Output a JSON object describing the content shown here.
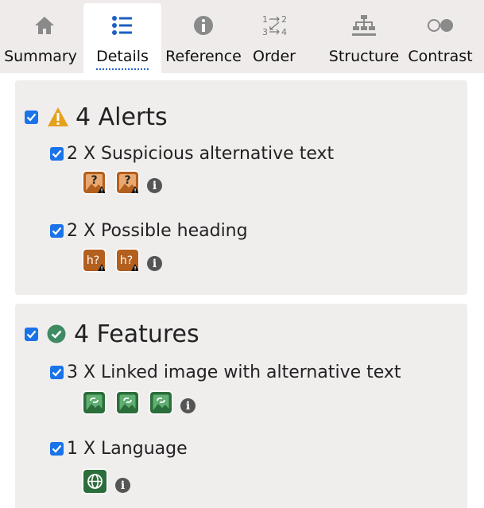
{
  "tabs": [
    {
      "label": "Summary",
      "icon": "home-icon",
      "active": false
    },
    {
      "label": "Details",
      "icon": "list-icon",
      "active": true
    },
    {
      "label": "Reference",
      "icon": "info-icon",
      "active": false
    },
    {
      "label": "Order",
      "icon": "order-icon",
      "active": false
    },
    {
      "label": "Structure",
      "icon": "structure-icon",
      "active": false
    },
    {
      "label": "Contrast",
      "icon": "contrast-icon",
      "active": false
    }
  ],
  "order_icon_text": {
    "top_left": "1",
    "top_right": "2",
    "bottom_left": "3",
    "bottom_right": "4"
  },
  "alerts": {
    "checked": true,
    "title": "4 Alerts",
    "status_icon": "warning-triangle-icon",
    "status_color": "#e5a11c",
    "items": [
      {
        "checked": true,
        "label": "2 X Suspicious alternative text",
        "count": 2,
        "icon": "suspicious-alt-text-icon",
        "badge_glyph": "?"
      },
      {
        "checked": true,
        "label": "2 X Possible heading",
        "count": 2,
        "icon": "possible-heading-icon",
        "badge_glyph": "h?"
      }
    ]
  },
  "features": {
    "checked": true,
    "title": "4 Features",
    "status_icon": "check-circle-icon",
    "status_color": "#3e8a62",
    "items": [
      {
        "checked": true,
        "label": "3 X Linked image with alternative text",
        "count": 3,
        "icon": "linked-image-icon"
      },
      {
        "checked": true,
        "label": "1 X Language",
        "count": 1,
        "icon": "language-globe-icon"
      }
    ]
  },
  "colors": {
    "checkbox": "#1a73e8",
    "alert_badge": "#b35f1e",
    "feature_badge": "#2c6e3b",
    "info_icon": "#555555",
    "tabbar_bg": "#eeebea",
    "panel_bg": "#f0eded"
  }
}
